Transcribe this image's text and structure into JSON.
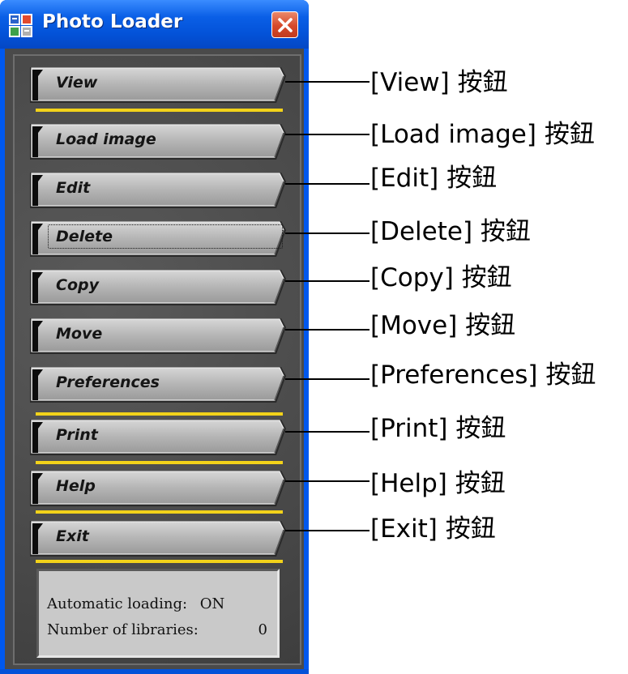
{
  "window": {
    "title": "Photo Loader",
    "icon": "photo-loader-app-icon",
    "close_icon": "close-icon"
  },
  "buttons": [
    {
      "label": "View"
    },
    {
      "label": "Load image"
    },
    {
      "label": "Edit"
    },
    {
      "label": "Delete",
      "focused": true
    },
    {
      "label": "Copy"
    },
    {
      "label": "Move"
    },
    {
      "label": "Preferences"
    },
    {
      "label": "Print"
    },
    {
      "label": "Help"
    },
    {
      "label": "Exit"
    }
  ],
  "status": {
    "automatic_loading_label": "Automatic loading:",
    "automatic_loading_value": "ON",
    "libraries_label": "Number of libraries:",
    "libraries_value": "0"
  },
  "annotations": [
    "[View] 按鈕",
    "[Load image] 按鈕",
    "[Edit] 按鈕",
    "[Delete] 按鈕",
    "[Copy] 按鈕",
    "[Move] 按鈕",
    "[Preferences] 按鈕",
    "[Print] 按鈕",
    "[Help] 按鈕",
    "[Exit] 按鈕"
  ],
  "colors": {
    "titlebar": "#0a5fe6",
    "separator": "#f2d21a",
    "button_face": "#b3b3b3",
    "panel": "#c9c9c9"
  }
}
